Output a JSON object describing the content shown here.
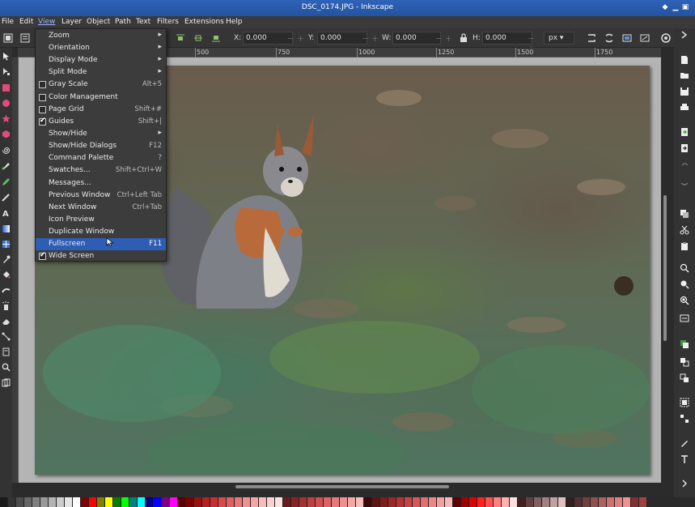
{
  "window": {
    "title": "DSC_0174.JPG - Inkscape"
  },
  "menubar": [
    "File",
    "Edit",
    "View",
    "Layer",
    "Object",
    "Path",
    "Text",
    "Filters",
    "Extensions",
    "Help"
  ],
  "toolbar": {
    "x_label": "X:",
    "x_value": "0.000",
    "y_label": "Y:",
    "y_value": "0.000",
    "w_label": "W:",
    "w_value": "0.000",
    "h_label": "H:",
    "h_value": "0.000",
    "unit": "px ▾"
  },
  "ruler": {
    "ticks": [
      "500",
      "750",
      "1000",
      "1250",
      "1500",
      "1750"
    ]
  },
  "view_menu": {
    "items": [
      {
        "label": "Zoom",
        "shortcut": "",
        "submenu": true,
        "check": "none"
      },
      {
        "label": "Orientation",
        "shortcut": "",
        "submenu": true,
        "check": "none"
      },
      {
        "label": "Display Mode",
        "shortcut": "",
        "submenu": true,
        "check": "none"
      },
      {
        "label": "Split Mode",
        "shortcut": "",
        "submenu": true,
        "check": "none"
      },
      {
        "label": "Gray Scale",
        "shortcut": "Alt+5",
        "submenu": false,
        "check": "off"
      },
      {
        "label": "Color Management",
        "shortcut": "",
        "submenu": false,
        "check": "off"
      },
      {
        "label": "Page Grid",
        "shortcut": "Shift+#",
        "submenu": false,
        "check": "off"
      },
      {
        "label": "Guides",
        "shortcut": "Shift+|",
        "submenu": false,
        "check": "on"
      },
      {
        "label": "Show/Hide",
        "shortcut": "",
        "submenu": true,
        "check": "none"
      },
      {
        "label": "Show/Hide Dialogs",
        "shortcut": "F12",
        "submenu": false,
        "check": "none"
      },
      {
        "label": "Command Palette",
        "shortcut": "?",
        "submenu": false,
        "check": "none"
      },
      {
        "label": "Swatches...",
        "shortcut": "Shift+Ctrl+W",
        "submenu": false,
        "check": "none"
      },
      {
        "label": "Messages...",
        "shortcut": "",
        "submenu": false,
        "check": "none"
      },
      {
        "label": "Previous Window",
        "shortcut": "Ctrl+Left Tab",
        "submenu": false,
        "check": "none"
      },
      {
        "label": "Next Window",
        "shortcut": "Ctrl+Tab",
        "submenu": false,
        "check": "none"
      },
      {
        "label": "Icon Preview",
        "shortcut": "",
        "submenu": false,
        "check": "none"
      },
      {
        "label": "Duplicate Window",
        "shortcut": "",
        "submenu": false,
        "check": "none"
      },
      {
        "label": "Fullscreen",
        "shortcut": "F11",
        "submenu": false,
        "check": "none",
        "highlighted": true
      },
      {
        "label": "Wide Screen",
        "shortcut": "",
        "submenu": false,
        "check": "on"
      }
    ],
    "submenu_arrow": "▸"
  },
  "palette": [
    "#1a1a1a",
    "#333333",
    "#4d4d4d",
    "#666666",
    "#808080",
    "#999999",
    "#b3b3b3",
    "#cccccc",
    "#e6e6e6",
    "#ffffff",
    "#800000",
    "#ff0000",
    "#808000",
    "#ffff00",
    "#008000",
    "#00ff00",
    "#008080",
    "#00ffff",
    "#000080",
    "#0000ff",
    "#800080",
    "#ff00ff",
    "#5a0000",
    "#7a0000",
    "#9a1010",
    "#b52020",
    "#c83030",
    "#d84a4a",
    "#e06060",
    "#e87878",
    "#f09090",
    "#f5a5a5",
    "#f8baba",
    "#fbd0d0",
    "#fde3e3",
    "#6a1a1a",
    "#8a2424",
    "#a33232",
    "#bb4040",
    "#cf5050",
    "#dd6464",
    "#e57a7a",
    "#ed9090",
    "#f2a8a8",
    "#f7c0c0",
    "#3a0a0a",
    "#5a1414",
    "#7a1e1e",
    "#9a2828",
    "#b43434",
    "#c84444",
    "#d85858",
    "#e27070",
    "#ea8888",
    "#f1a0a0",
    "#f6b8b8",
    "#600000",
    "#a00000",
    "#e00000",
    "#ff2020",
    "#ff5050",
    "#ff8080",
    "#ffb0b0",
    "#ffe0e0",
    "#402020",
    "#604040",
    "#806060",
    "#a08080",
    "#c0a0a0",
    "#e0c0c0",
    "#302020",
    "#503030",
    "#704040",
    "#905050",
    "#b06060",
    "#d07070",
    "#e08080",
    "#f09090",
    "#803030",
    "#a04040"
  ]
}
